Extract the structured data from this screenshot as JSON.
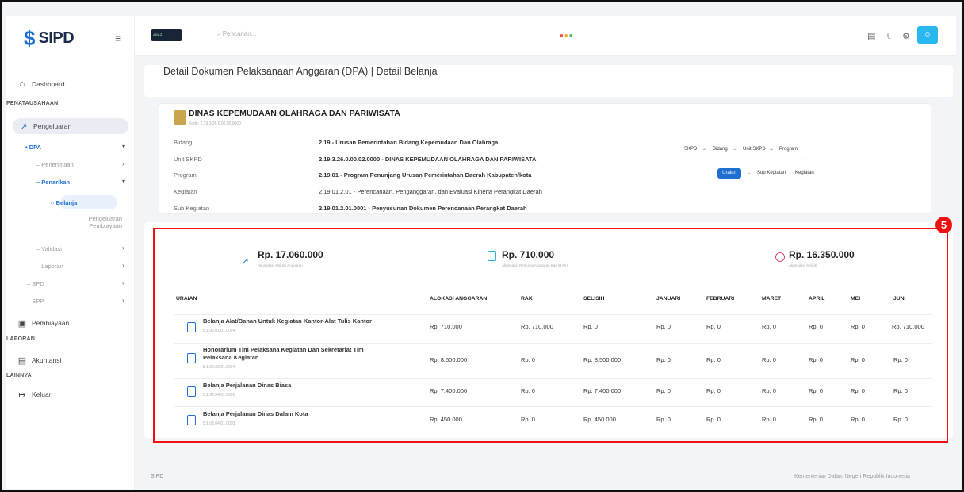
{
  "app": {
    "logo_text": "SIPD",
    "year_badge": "2023"
  },
  "sidebar": {
    "dashboard": "Dashboard",
    "sec_penatausahaan": "PENATAUSAHAAN",
    "pengeluaran": "Pengeluaran",
    "dpa": "DPA",
    "penerimaan": "Penerimaan",
    "penarikan": "Penarikan",
    "belanja": "Belanja",
    "pengeluaran_pembiayaan": [
      "Pengeluaran",
      "Pembiayaan"
    ],
    "validasi": "Validasi",
    "laporan": "Laporan",
    "spd": "SPD",
    "spp": "SPP",
    "pembiayaan": "Pembiayaan",
    "sec_laporan": "LAPORAN",
    "akuntansi": "Akuntansi",
    "sec_lainnya": "LAINNYA",
    "keluar": "Keluar"
  },
  "topbar": {
    "search_placeholder": "Pencarian..."
  },
  "page": {
    "title": "Detail Dokumen Pelaksanaan Anggaran (DPA) | Detail Belanja"
  },
  "instansi": {
    "name": "DINAS KEPEMUDAAN OLAHRAGA DAN PARIWISATA",
    "kode": "Kode: 2.19.3.26.0.00.02.0000"
  },
  "details": [
    {
      "label": "Bidang",
      "value": "2.19 - Urusan Pemerintahan Bidang Kepemudaan Dan Olahraga"
    },
    {
      "label": "Unit SKPD",
      "value": "2.19.3.26.0.00.02.0000 - DINAS KEPEMUDAAN OLAHRAGA DAN PARIWISATA"
    },
    {
      "label": "Program",
      "value": "2.19.01 - Program Penunjang Urusan Pemerintahan Daerah Kabupaten/kota"
    },
    {
      "label": "Kegiatan",
      "value": "2.19.01.2.01 - Perencanaan, Penganggaran, dan Evaluasi Kinerja Perangkat Daerah"
    },
    {
      "label": "Sub Kegiatan",
      "value": "2.19.01.2.01.0001 - Penyusunan Dokumen Perencanaan Perangkat Daerah"
    }
  ],
  "flow": {
    "row1": [
      "SKPD",
      "Bidang",
      "Unit SKPD",
      "Program"
    ],
    "row2": [
      "Uraian",
      "Sub Kegiatan",
      "Kegiatan"
    ]
  },
  "summary": [
    {
      "value": "Rp. 17.060.000",
      "label": "Akumulasi Alokasi Anggaran"
    },
    {
      "value": "Rp. 710.000",
      "label": "Akumulasi Rencana Anggaran Kas (RAK)"
    },
    {
      "value": "Rp. 16.350.000",
      "label": "Akumulasi Selisih"
    }
  ],
  "annotation_number": "5",
  "table": {
    "headers": [
      "URAIAN",
      "ALOKASI ANGGARAN",
      "RAK",
      "SELISIH",
      "JANUARI",
      "FEBRUARI",
      "MARET",
      "APRIL",
      "MEI",
      "JUNI"
    ],
    "rows": [
      {
        "title": [
          "Belanja Alat/Bahan Untuk Kegiatan Kantor-Alat Tulis Kantor"
        ],
        "code": "5.1.02.01.01.0024",
        "values": [
          "Rp. 710.000",
          "Rp. 710.000",
          "Rp. 0",
          "Rp. 0",
          "Rp. 0",
          "Rp. 0",
          "Rp. 0",
          "Rp. 0",
          "Rp. 710.000"
        ]
      },
      {
        "title": [
          "Honorarium Tim Pelaksana Kegiatan Dan Sekretariat Tim",
          "Pelaksana Kegiatan"
        ],
        "code": "5.1.02.02.01.0004",
        "values": [
          "Rp. 8.500.000",
          "Rp. 0",
          "Rp. 8.500.000",
          "Rp. 0",
          "Rp. 0",
          "Rp. 0",
          "Rp. 0",
          "Rp. 0",
          "Rp. 0"
        ]
      },
      {
        "title": [
          "Belanja Perjalanan Dinas Biasa"
        ],
        "code": "5.1.02.04.01.0001",
        "values": [
          "Rp. 7.400.000",
          "Rp. 0",
          "Rp. 7.400.000",
          "Rp. 0",
          "Rp. 0",
          "Rp. 0",
          "Rp. 0",
          "Rp. 0",
          "Rp. 0"
        ]
      },
      {
        "title": [
          "Belanja Perjalanan Dinas Dalam Kota"
        ],
        "code": "5.1.02.04.01.0003",
        "values": [
          "Rp. 450.000",
          "Rp. 0",
          "Rp. 450.000",
          "Rp. 0",
          "Rp. 0",
          "Rp. 0",
          "Rp. 0",
          "Rp. 0",
          "Rp. 0"
        ]
      }
    ]
  },
  "footer": {
    "left": "SIPD",
    "right": "Kementerian Dalam Negeri Republik Indonesia"
  },
  "colors": {
    "accent": "#1f6fd1",
    "annotation": "#e11111"
  }
}
